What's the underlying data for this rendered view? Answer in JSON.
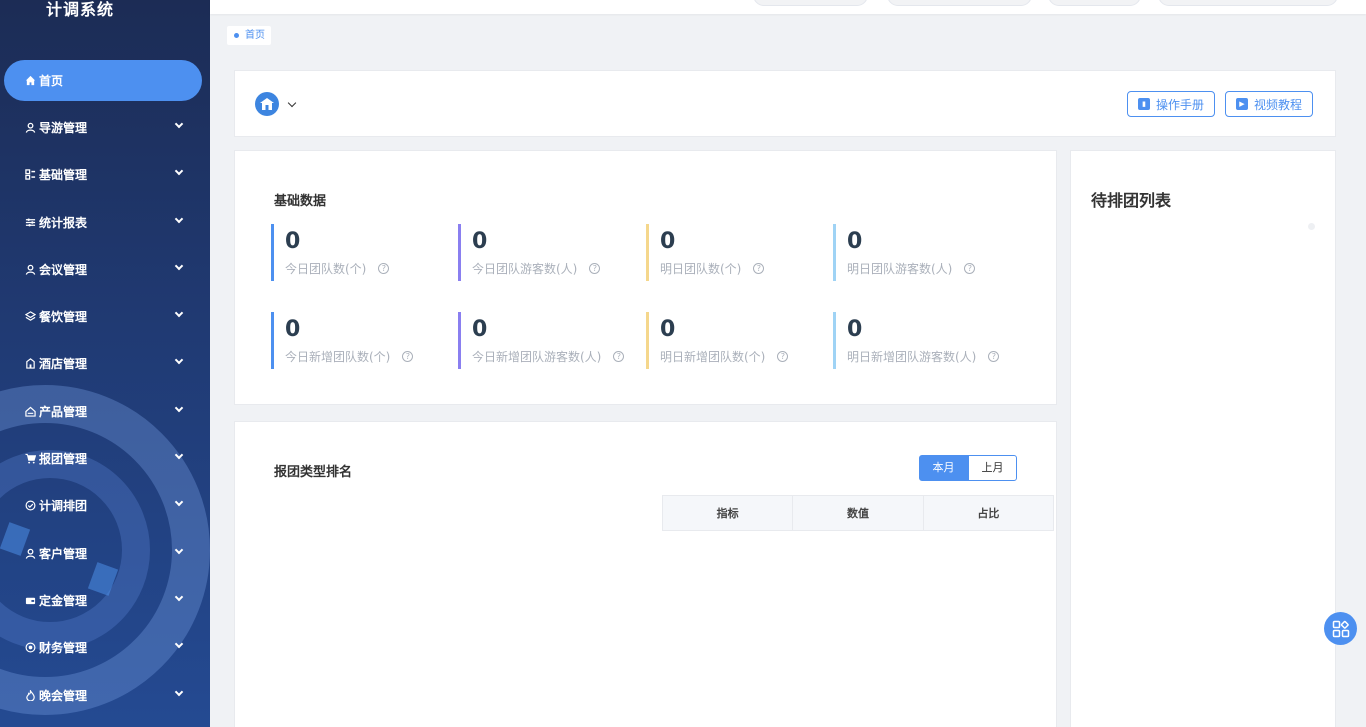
{
  "app": {
    "title": "计调系统"
  },
  "sidebar": {
    "items": [
      {
        "label": "首页",
        "icon": "home-icon",
        "active": true
      },
      {
        "label": "导游管理",
        "icon": "user-icon"
      },
      {
        "label": "基础管理",
        "icon": "grid-icon"
      },
      {
        "label": "统计报表",
        "icon": "sliders-icon"
      },
      {
        "label": "会议管理",
        "icon": "user-icon"
      },
      {
        "label": "餐饮管理",
        "icon": "layers-icon"
      },
      {
        "label": "酒店管理",
        "icon": "building-icon"
      },
      {
        "label": "产品管理",
        "icon": "home-outline-icon"
      },
      {
        "label": "报团管理",
        "icon": "cart-icon"
      },
      {
        "label": "计调排团",
        "icon": "check-circle-icon"
      },
      {
        "label": "客户管理",
        "icon": "user-icon"
      },
      {
        "label": "定金管理",
        "icon": "wallet-icon"
      },
      {
        "label": "财务管理",
        "icon": "target-icon"
      },
      {
        "label": "晚会管理",
        "icon": "flame-icon"
      }
    ]
  },
  "breadcrumb": {
    "current": "首页"
  },
  "toolbar": {
    "manual_label": "操作手册",
    "video_label": "视频教程"
  },
  "basic": {
    "title": "基础数据",
    "stats": [
      {
        "value": "0",
        "label": "今日团队数(个)",
        "color": "#4d90f0"
      },
      {
        "value": "0",
        "label": "今日团队游客数(人)",
        "color": "#8a7ff0"
      },
      {
        "value": "0",
        "label": "明日团队数(个)",
        "color": "#f5d78c"
      },
      {
        "value": "0",
        "label": "明日团队游客数(人)",
        "color": "#9fd3f5"
      },
      {
        "value": "0",
        "label": "今日新增团队数(个)",
        "color": "#4d90f0"
      },
      {
        "value": "0",
        "label": "今日新增团队游客数(人)",
        "color": "#8a7ff0"
      },
      {
        "value": "0",
        "label": "明日新增团队数(个)",
        "color": "#f5d78c"
      },
      {
        "value": "0",
        "label": "明日新增团队游客数(人)",
        "color": "#9fd3f5"
      }
    ]
  },
  "ranking": {
    "title": "报团类型排名",
    "tabs": {
      "current": "本月",
      "previous": "上月"
    },
    "columns": [
      "指标",
      "数值",
      "占比"
    ]
  },
  "pending": {
    "title": "待排团列表"
  }
}
